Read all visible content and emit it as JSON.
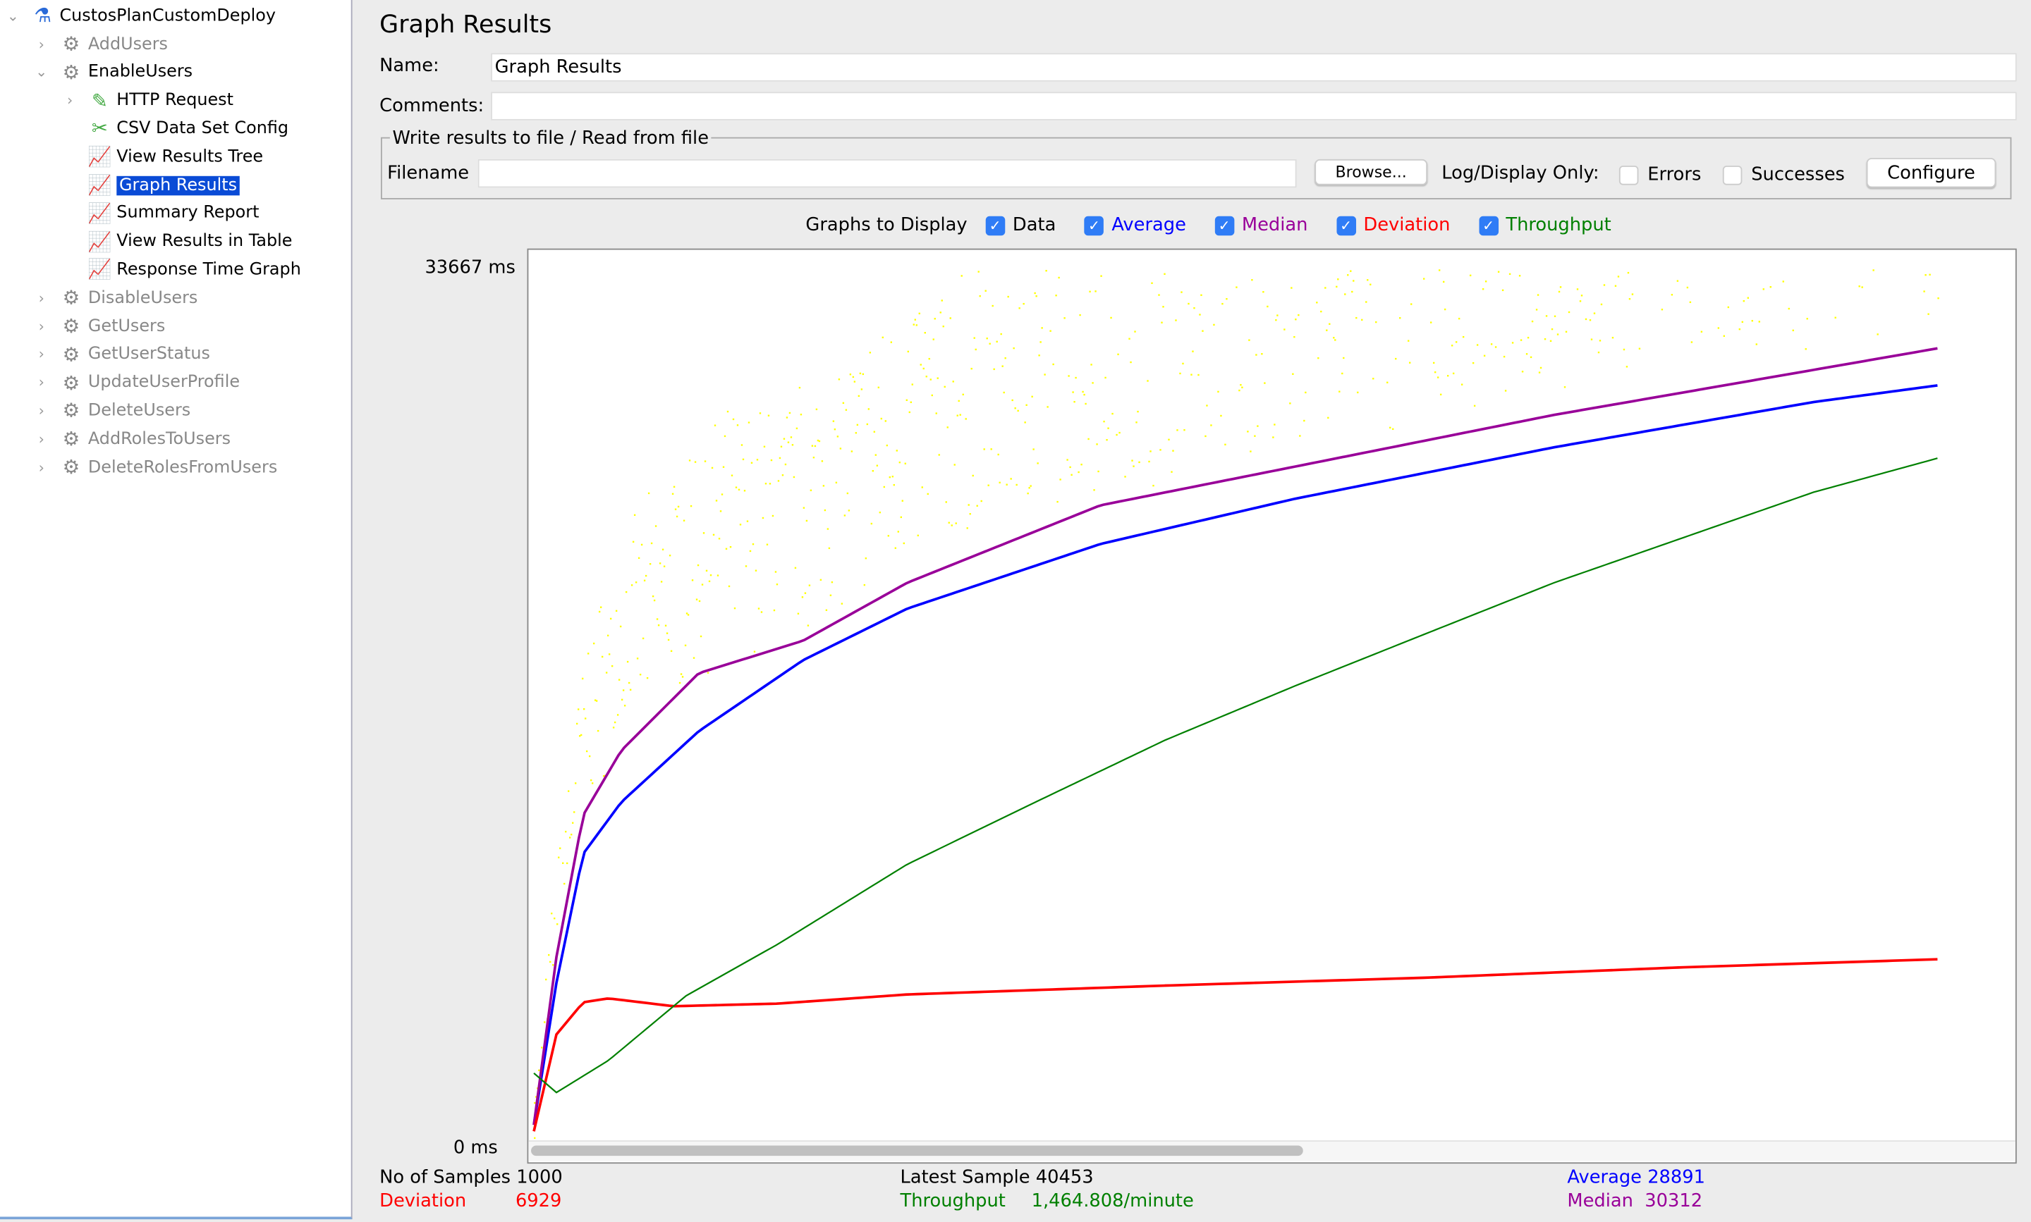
{
  "tree": {
    "root": "CustosPlanCustomDeploy",
    "items": [
      {
        "label": "AddUsers",
        "icon": "gear-icon",
        "level": 1,
        "expanded": false,
        "disabled": true
      },
      {
        "label": "EnableUsers",
        "icon": "gear-icon",
        "level": 1,
        "expanded": true,
        "disabled": false
      },
      {
        "label": "HTTP Request",
        "icon": "pipette-icon",
        "level": 2,
        "expanded": false,
        "disabled": false
      },
      {
        "label": "CSV Data Set Config",
        "icon": "tools-icon",
        "level": 2,
        "disabled": false
      },
      {
        "label": "View Results Tree",
        "icon": "graph-icon",
        "level": 2,
        "disabled": false
      },
      {
        "label": "Graph Results",
        "icon": "graph-icon",
        "level": 2,
        "disabled": false,
        "selected": true
      },
      {
        "label": "Summary Report",
        "icon": "graph-icon",
        "level": 2,
        "disabled": false
      },
      {
        "label": "View Results in Table",
        "icon": "graph-icon",
        "level": 2,
        "disabled": false
      },
      {
        "label": "Response Time Graph",
        "icon": "graph-icon",
        "level": 2,
        "disabled": false
      },
      {
        "label": "DisableUsers",
        "icon": "gear-icon",
        "level": 1,
        "expanded": false,
        "disabled": true
      },
      {
        "label": "GetUsers",
        "icon": "gear-icon",
        "level": 1,
        "expanded": false,
        "disabled": true
      },
      {
        "label": "GetUserStatus",
        "icon": "gear-icon",
        "level": 1,
        "expanded": false,
        "disabled": true
      },
      {
        "label": "UpdateUserProfile",
        "icon": "gear-icon",
        "level": 1,
        "expanded": false,
        "disabled": true
      },
      {
        "label": "DeleteUsers",
        "icon": "gear-icon",
        "level": 1,
        "expanded": false,
        "disabled": true
      },
      {
        "label": "AddRolesToUsers",
        "icon": "gear-icon",
        "level": 1,
        "expanded": false,
        "disabled": true
      },
      {
        "label": "DeleteRolesFromUsers",
        "icon": "gear-icon",
        "level": 1,
        "expanded": false,
        "disabled": true
      }
    ]
  },
  "panel": {
    "title": "Graph Results",
    "name_label": "Name:",
    "name_value": "Graph Results",
    "comments_label": "Comments:",
    "comments_value": "",
    "file_group_title": "Write results to file / Read from file",
    "filename_label": "Filename",
    "filename_value": "",
    "browse_label": "Browse...",
    "log_display_label": "Log/Display Only:",
    "errors_label": "Errors",
    "errors_checked": false,
    "successes_label": "Successes",
    "successes_checked": false,
    "configure_label": "Configure",
    "graphs_label": "Graphs to Display",
    "graphs": [
      {
        "label": "Data",
        "checked": true,
        "color": "#000000"
      },
      {
        "label": "Average",
        "checked": true,
        "color": "#0000ff"
      },
      {
        "label": "Median",
        "checked": true,
        "color": "#990099"
      },
      {
        "label": "Deviation",
        "checked": true,
        "color": "#ff0000"
      },
      {
        "label": "Throughput",
        "checked": true,
        "color": "#008000"
      }
    ]
  },
  "chart_data": {
    "type": "line",
    "y_max_label": "33667  ms",
    "y_min_label": "0  ms",
    "ylim": [
      0,
      33667
    ],
    "xlim": [
      0,
      1000
    ],
    "data_color": "#ffff00",
    "series": [
      {
        "name": "Average",
        "color": "#0000ff",
        "x": [
          2,
          18,
          37,
          64,
          119,
          193,
          267,
          404,
          542,
          726,
          910,
          1000
        ],
        "y": [
          592,
          6023,
          10960,
          12935,
          15650,
          18366,
          20340,
          22810,
          24540,
          26510,
          28240,
          28891
        ]
      },
      {
        "name": "Median",
        "color": "#990099",
        "x": [
          2,
          18,
          37,
          64,
          119,
          193,
          267,
          404,
          542,
          726,
          910,
          1000
        ],
        "y": [
          592,
          7010,
          12440,
          14910,
          17870,
          19110,
          21330,
          24290,
          25770,
          27750,
          29470,
          30312
        ]
      },
      {
        "name": "Deviation",
        "color": "#ff0000",
        "x": [
          2,
          18,
          37,
          55,
          101,
          175,
          267,
          450,
          634,
          818,
          1000
        ],
        "y": [
          345,
          4050,
          5280,
          5430,
          5130,
          5230,
          5580,
          5920,
          6220,
          6620,
          6929
        ]
      },
      {
        "name": "Throughput",
        "color": "#008000",
        "x": [
          2,
          18,
          55,
          110,
          175,
          267,
          358,
          450,
          542,
          634,
          726,
          818,
          910,
          1000
        ],
        "y": [
          2570,
          1830,
          3060,
          5530,
          7500,
          10560,
          12940,
          15310,
          17380,
          19360,
          21330,
          23060,
          24790,
          26120
        ]
      }
    ]
  },
  "stats": {
    "samples_label": "No of Samples",
    "samples_value": "1000",
    "latest_label": "Latest Sample",
    "latest_value": "40453",
    "average_label": "Average",
    "average_value": "28891",
    "deviation_label": "Deviation",
    "deviation_value": "6929",
    "throughput_label": "Throughput",
    "throughput_value": "1,464.808/minute",
    "median_label": "Median",
    "median_value": "30312"
  }
}
